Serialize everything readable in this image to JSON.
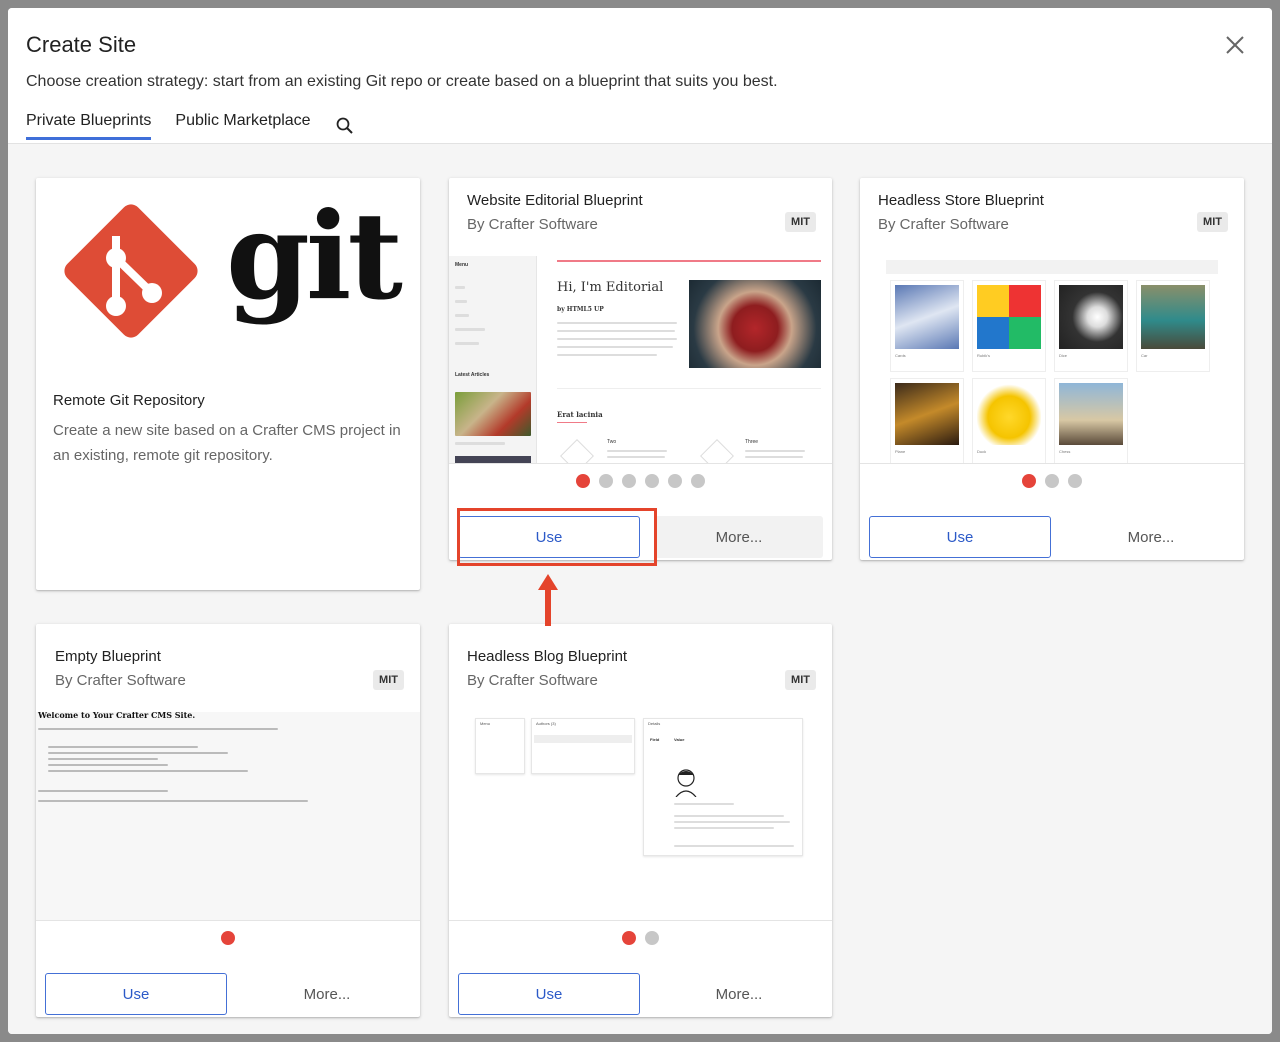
{
  "dialog": {
    "title": "Create Site",
    "subtitle": "Choose creation strategy: start from an existing Git repo or create based on a blueprint that suits you best.",
    "close_icon": "close-icon",
    "tabs": [
      {
        "label": "Private Blueprints",
        "active": true
      },
      {
        "label": "Public Marketplace",
        "active": false
      }
    ],
    "search_icon": "search-icon"
  },
  "colors": {
    "accent": "#3f6fd9",
    "git_logo": "#de4c36",
    "dot_active": "#e5443a",
    "dot_inactive": "#c7c7c7",
    "highlight": "#e4442b"
  },
  "cards": {
    "git": {
      "logo_text": "git",
      "title": "Remote Git Repository",
      "description": "Create a new site based on a Crafter CMS project in an existing, remote git repository."
    },
    "editorial": {
      "title": "Website Editorial Blueprint",
      "author": "By Crafter Software",
      "license": "MIT",
      "preview": {
        "menu": "Menu",
        "heading": "Hi, I'm Editorial",
        "byline": "by HTML5 UP",
        "latest": "Latest Articles",
        "section": "Erat lacinia",
        "col_two": "Two",
        "col_three": "Three"
      },
      "slides": 6,
      "active_slide": 1,
      "use_label": "Use",
      "more_label": "More..."
    },
    "store": {
      "title": "Headless Store Blueprint",
      "author": "By Crafter Software",
      "license": "MIT",
      "products": [
        "Cards",
        "Rubik's",
        "Dice",
        "Car",
        "Plane",
        "Duck",
        "Chess"
      ],
      "slides": 3,
      "active_slide": 1,
      "use_label": "Use",
      "more_label": "More..."
    },
    "empty": {
      "title": "Empty Blueprint",
      "author": "By Crafter Software",
      "license": "MIT",
      "preview": {
        "heading": "Welcome to Your Crafter CMS Site."
      },
      "slides": 1,
      "active_slide": 1,
      "use_label": "Use",
      "more_label": "More..."
    },
    "blog": {
      "title": "Headless Blog Blueprint",
      "author": "By Crafter Software",
      "license": "MIT",
      "preview": {
        "panel_left": "Menu",
        "panel_mid": "Authors (3)",
        "panel_right": "Details",
        "col_field": "Field",
        "col_value": "Value"
      },
      "slides": 2,
      "active_slide": 1,
      "use_label": "Use",
      "more_label": "More..."
    }
  }
}
